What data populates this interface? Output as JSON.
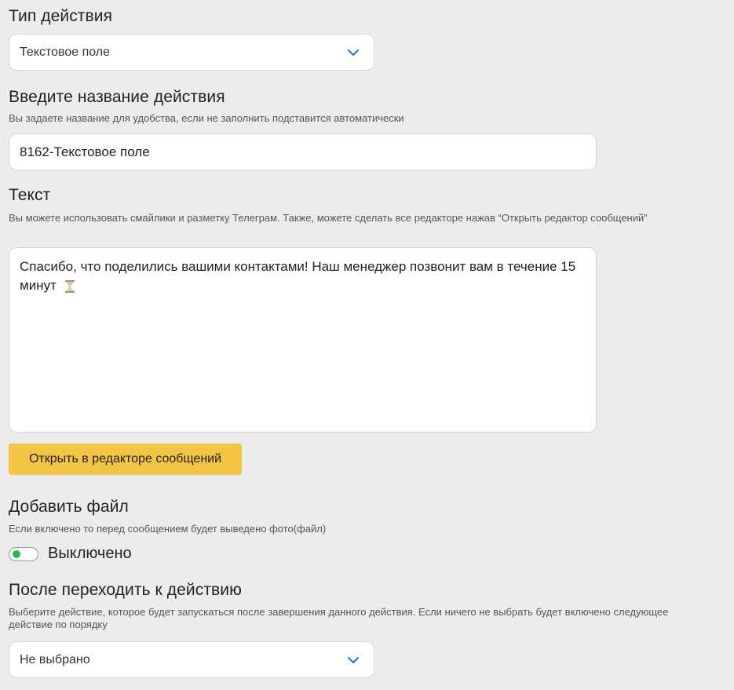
{
  "action_type": {
    "title": "Тип действия",
    "value": "Текстовое поле"
  },
  "action_name": {
    "title": "Введите название действия",
    "hint": "Вы задаете название для удобства, если не заполнить подставится автоматически",
    "value": "8162-Текстовое поле"
  },
  "text": {
    "title": "Текст",
    "hint": "Вы можете использовать смайлики и разметку Телеграм. Также, можете сделать все редакторе нажав “Открыть редактор сообщений”",
    "value": "Спасибо, что поделились вашими контактами! Наш менеджер позвонит вам в течение 15 минут",
    "emoji_icon": "hourglass-icon",
    "open_editor_label": "Открыть в редакторе сообщений",
    "button_color": "#f4c542"
  },
  "add_file": {
    "title": "Добавить файл",
    "hint": "Если включено то перед сообщением будет выведено фото(файл)",
    "toggle_label": "Выключено",
    "toggle_on": false,
    "knob_color": "#1fbf4b"
  },
  "next_action": {
    "title": "После переходить к действию",
    "hint": "Выберите действие, которое будет запускаться после завершения данного действия. Если ничего не выбрать будет включено следующее действие по порядку",
    "value": "Не выбрано"
  },
  "accent_color": "#1a73e8"
}
